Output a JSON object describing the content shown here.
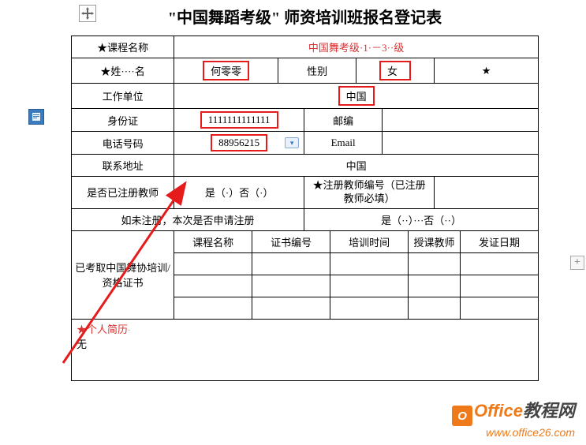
{
  "title": "\"中国舞蹈考级\" 师资培训班报名登记表",
  "row_course": {
    "label": "★课程名称",
    "value": "中国舞考级·1·－3··级"
  },
  "row_name": {
    "label": "★姓····名",
    "value": "何零零",
    "gender_label": "性别",
    "gender_value": "女",
    "extra": "★"
  },
  "row_work": {
    "label": "工作单位",
    "value": "中国"
  },
  "row_id": {
    "label": "身份证",
    "value": "1111111111111",
    "post_label": "邮编",
    "post_value": ""
  },
  "row_phone": {
    "label": "电话号码",
    "value": "88956215",
    "email_label": "Email",
    "email_value": ""
  },
  "row_addr": {
    "label": "联系地址",
    "value": "中国"
  },
  "row_reg": {
    "label": "是否已注册教师",
    "value": "是（·）否（·）",
    "num_label": "★注册教师编号（已注册教师必填）",
    "num_value": ""
  },
  "row_apply": {
    "label": "如未注册，本次是否申请注册",
    "value": "是（··）···否（··）"
  },
  "cert_header": {
    "label": "已考取中国舞协培训/资格证书",
    "c1": "课程名称",
    "c2": "证书编号",
    "c3": "培训时间",
    "c4": "授课教师",
    "c5": "发证日期"
  },
  "resume": {
    "label": "★个人简历",
    "content": "无"
  },
  "watermark": {
    "brand": "Office",
    "suffix": "教程网",
    "url": "www.office26.com"
  }
}
